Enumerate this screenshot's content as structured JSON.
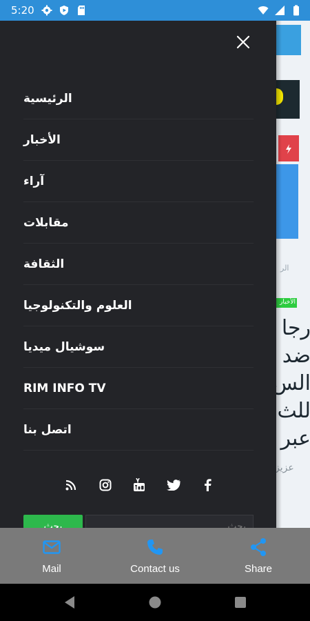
{
  "status_bar": {
    "time": "5:20",
    "icons_left": [
      "gear-icon",
      "shield-play-icon",
      "sd-card-icon"
    ],
    "icons_right": [
      "wifi-icon",
      "signal-icon",
      "battery-icon"
    ],
    "color": "#2e8fd8"
  },
  "drawer": {
    "close_icon": "close-icon",
    "menu": [
      {
        "label": "الرئيسية"
      },
      {
        "label": "الأخبار"
      },
      {
        "label": "آراء"
      },
      {
        "label": "مقابلات"
      },
      {
        "label": "الثقافة"
      },
      {
        "label": "العلوم والتكنولوجيا"
      },
      {
        "label": "سوشيال ميديا"
      },
      {
        "label": "RIM INFO TV"
      },
      {
        "label": "اتصل بنا"
      }
    ],
    "social": [
      "facebook-icon",
      "twitter-icon",
      "youtube-icon",
      "instagram-icon",
      "rss-icon"
    ],
    "search": {
      "placeholder": "بحث",
      "button_label": "بحث"
    },
    "background": "#232428"
  },
  "background_page": {
    "category": "الر",
    "badge": "الأخبار",
    "headline": "رجا ضد الس للث عبر",
    "author": "عزيز"
  },
  "action_bar": {
    "items": [
      {
        "label": "Mail",
        "icon": "mail-icon"
      },
      {
        "label": "Contact us",
        "icon": "phone-icon"
      },
      {
        "label": "Share",
        "icon": "share-icon"
      }
    ],
    "accent": "#2196f3"
  },
  "nav_bar": {
    "buttons": [
      "back-icon",
      "home-icon",
      "recents-icon"
    ]
  }
}
